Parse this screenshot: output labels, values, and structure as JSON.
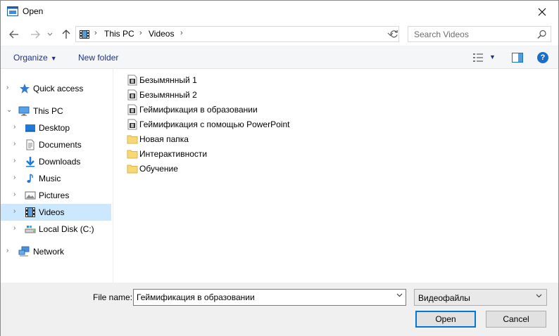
{
  "window": {
    "title": "Open"
  },
  "address": {
    "crumbs": [
      "This PC",
      "Videos"
    ]
  },
  "search": {
    "placeholder": "Search Videos"
  },
  "toolbar": {
    "organize_label": "Organize",
    "new_folder_label": "New folder",
    "help_label": "?"
  },
  "nav": {
    "quick_access": "Quick access",
    "this_pc": "This PC",
    "desktop": "Desktop",
    "documents": "Documents",
    "downloads": "Downloads",
    "music": "Music",
    "pictures": "Pictures",
    "videos": "Videos",
    "local_disk": "Local Disk (C:)",
    "network": "Network"
  },
  "files": [
    {
      "name": "Безымянный 1",
      "type": "video"
    },
    {
      "name": "Безымянный 2",
      "type": "video"
    },
    {
      "name": "Геймификация в образовании",
      "type": "video",
      "selected": true
    },
    {
      "name": "Геймификация с помощью PowerPoint",
      "type": "video"
    },
    {
      "name": "Новая папка",
      "type": "folder"
    },
    {
      "name": "Интерактивности",
      "type": "folder"
    },
    {
      "name": "Обучение",
      "type": "folder"
    }
  ],
  "bottom": {
    "file_name_label": "File name:",
    "file_name_value": "Геймификация в образовании",
    "file_type_value": "Видеофайлы",
    "open_label": "Open",
    "cancel_label": "Cancel"
  },
  "colors": {
    "selection": "#cce8ff",
    "accent": "#0078d7",
    "command_text": "#1e3287"
  }
}
